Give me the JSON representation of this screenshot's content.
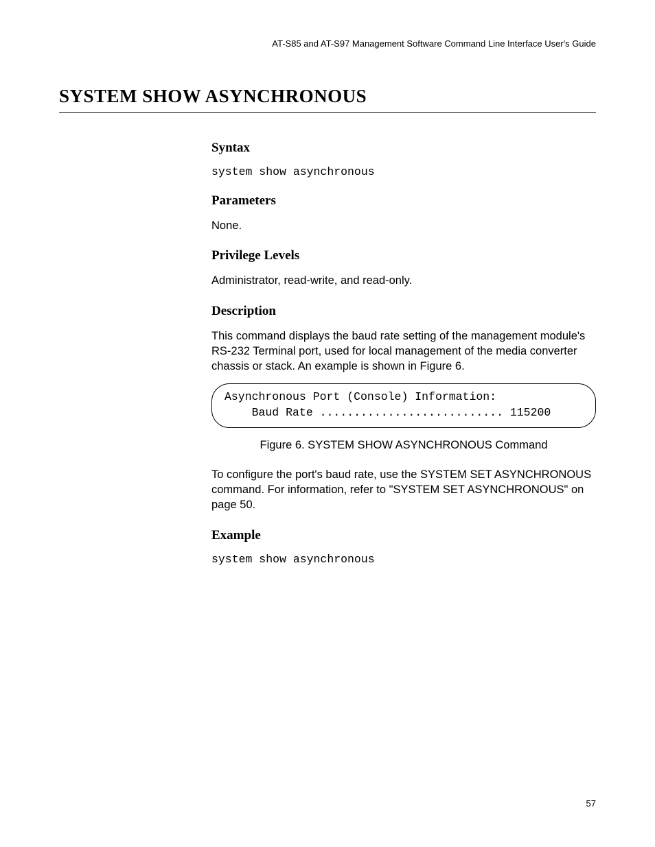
{
  "header": {
    "running": "AT-S85 and AT-S97 Management Software Command Line Interface User's Guide"
  },
  "title": "SYSTEM SHOW ASYNCHRONOUS",
  "sections": {
    "syntax": {
      "heading": "Syntax",
      "code": "system show asynchronous"
    },
    "parameters": {
      "heading": "Parameters",
      "text": "None."
    },
    "privilege": {
      "heading": "Privilege Levels",
      "text": "Administrator, read-write, and read-only."
    },
    "description": {
      "heading": "Description",
      "text": "This command displays the baud rate setting of the management module's RS-232 Terminal port, used for local management of the media converter chassis or stack. An example is shown in Figure 6.",
      "console_lines": "Asynchronous Port (Console) Information:\n    Baud Rate ........................... 115200",
      "figure_caption": "Figure 6. SYSTEM SHOW ASYNCHRONOUS Command",
      "postfigure": "To configure the port's baud rate, use the SYSTEM SET ASYNCHRONOUS command. For information, refer to \"SYSTEM SET ASYNCHRONOUS\" on page 50."
    },
    "example": {
      "heading": "Example",
      "code": "system show asynchronous"
    }
  },
  "page_number": "57"
}
